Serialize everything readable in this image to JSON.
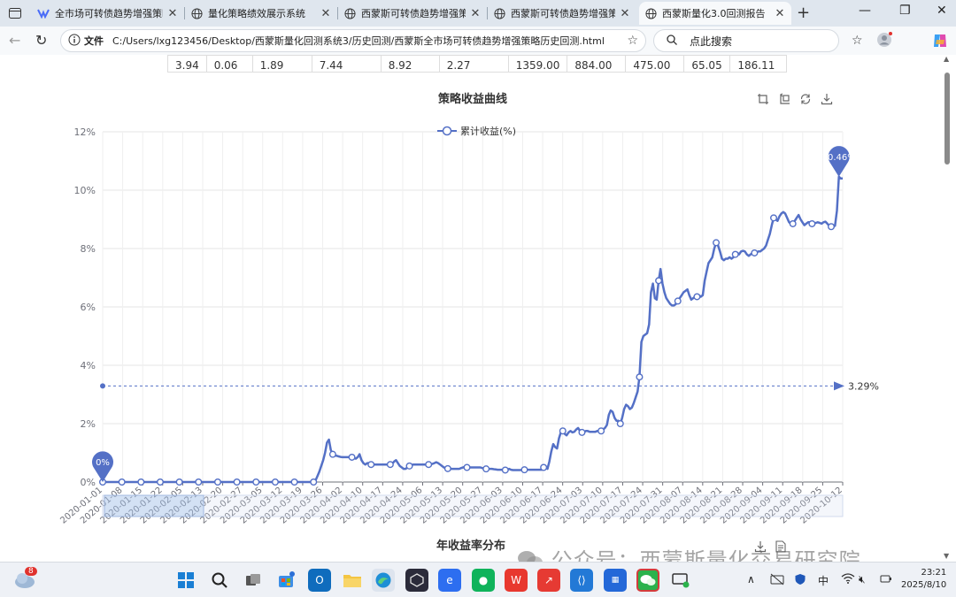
{
  "browser": {
    "tabs": [
      {
        "label": "全市场可转债趋势增强策略",
        "active": false
      },
      {
        "label": "量化策略绩效展示系统",
        "active": false
      },
      {
        "label": "西蒙斯可转债趋势增强策略",
        "active": false
      },
      {
        "label": "西蒙斯可转债趋势增强策略",
        "active": false
      },
      {
        "label": "西蒙斯量化3.0回测报告",
        "active": true
      }
    ],
    "file_label": "文件",
    "url": "C:/Users/lxg123456/Desktop/西蒙斯量化回测系统3/历史回测/西蒙斯全市场可转债趋势增强策略历史回测.html",
    "search_placeholder": "点此搜索"
  },
  "summary_row": [
    "3.94",
    "0.06",
    "1.89",
    "7.44",
    "8.92",
    "2.27",
    "1359.00",
    "884.00",
    "475.00",
    "65.05",
    "186.11"
  ],
  "chart": {
    "title": "策略收益曲线",
    "legend": "累计收益(%)",
    "color": "#5470c6",
    "y_ticks": [
      "0%",
      "2%",
      "4%",
      "6%",
      "8%",
      "10%",
      "12%"
    ],
    "x_ticks": [
      "2020-01-01",
      "2020-01-08",
      "2020-01-15",
      "2020-01-22",
      "2020-02-05",
      "2020-02-13",
      "2020-02-20",
      "2020-02-27",
      "2020-03-05",
      "2020-03-12",
      "2020-03-19",
      "2020-03-26",
      "2020-04-02",
      "2020-04-10",
      "2020-04-17",
      "2020-04-24",
      "2020-05-06",
      "2020-05-13",
      "2020-05-20",
      "2020-05-27",
      "2020-06-03",
      "2020-06-10",
      "2020-06-17",
      "2020-06-24",
      "2020-07-03",
      "2020-07-10",
      "2020-07-17",
      "2020-07-24",
      "2020-07-31",
      "2020-08-07",
      "2020-08-14",
      "2020-08-21",
      "2020-08-28",
      "2020-09-04",
      "2020-09-11",
      "2020-09-18",
      "2020-09-25",
      "2020-10-12"
    ],
    "average_label": "3.29%",
    "min_label": "0%",
    "max_label": "10.46%"
  },
  "chart_data": {
    "type": "line",
    "ylim": [
      0,
      12
    ],
    "average": 3.29,
    "series": [
      {
        "name": "累计收益(%)",
        "values": [
          0,
          0,
          0,
          0,
          0,
          0,
          0,
          0,
          0,
          0,
          0,
          0,
          0,
          0,
          0,
          0,
          0,
          0,
          0,
          0,
          0,
          0,
          0,
          0,
          0,
          0,
          0,
          0,
          0,
          0,
          0,
          0,
          0,
          0,
          0,
          0,
          0,
          0,
          0,
          0,
          0,
          0,
          0,
          0,
          0,
          0,
          0,
          0,
          0,
          0,
          0,
          0,
          0,
          0,
          0,
          0,
          0,
          0,
          0,
          0,
          0,
          0,
          0,
          0,
          0,
          0,
          0,
          0,
          0,
          0,
          0,
          0,
          0,
          0,
          0,
          0,
          0,
          0,
          0,
          0,
          0,
          0,
          0,
          0,
          0,
          0,
          0,
          0,
          0,
          0,
          0,
          0,
          0,
          0,
          0,
          0,
          0,
          0,
          0,
          0,
          0,
          0,
          0,
          0,
          0,
          0,
          0,
          0,
          0,
          0,
          0,
          0.05,
          0.2,
          0.35,
          0.55,
          0.75,
          1.0,
          1.35,
          1.45,
          1.1,
          0.95,
          0.9,
          0.9,
          0.88,
          0.86,
          0.85,
          0.85,
          0.85,
          0.85,
          0.85,
          0.85,
          0.82,
          0.8,
          0.85,
          0.95,
          0.75,
          0.65,
          0.6,
          0.65,
          0.65,
          0.6,
          0.6,
          0.6,
          0.6,
          0.6,
          0.6,
          0.6,
          0.6,
          0.6,
          0.6,
          0.6,
          0.62,
          0.7,
          0.75,
          0.65,
          0.55,
          0.5,
          0.45,
          0.45,
          0.5,
          0.55,
          0.58,
          0.6,
          0.6,
          0.6,
          0.6,
          0.6,
          0.6,
          0.6,
          0.6,
          0.6,
          0.6,
          0.62,
          0.65,
          0.68,
          0.65,
          0.6,
          0.55,
          0.5,
          0.48,
          0.46,
          0.45,
          0.45,
          0.45,
          0.45,
          0.45,
          0.45,
          0.48,
          0.5,
          0.52,
          0.5,
          0.5,
          0.5,
          0.5,
          0.5,
          0.5,
          0.5,
          0.5,
          0.48,
          0.46,
          0.45,
          0.45,
          0.45,
          0.45,
          0.44,
          0.43,
          0.42,
          0.42,
          0.42,
          0.42,
          0.41,
          0.42,
          0.45,
          0.42,
          0.41,
          0.41,
          0.41,
          0.41,
          0.41,
          0.42,
          0.42,
          0.42,
          0.42,
          0.42,
          0.42,
          0.42,
          0.42,
          0.42,
          0.42,
          0.42,
          0.5,
          0.55,
          0.45,
          0.7,
          1.05,
          1.3,
          1.2,
          1.15,
          1.5,
          1.7,
          1.75,
          1.65,
          1.6,
          1.7,
          1.75,
          1.7,
          1.72,
          1.8,
          1.85,
          1.75,
          1.7,
          1.7,
          1.75,
          1.75,
          1.72,
          1.72,
          1.72,
          1.72,
          1.75,
          1.75,
          1.75,
          1.8,
          1.85,
          1.95,
          2.3,
          2.45,
          2.4,
          2.2,
          2.1,
          2.1,
          2.0,
          2.2,
          2.5,
          2.65,
          2.6,
          2.5,
          2.55,
          2.7,
          2.9,
          3.1,
          3.6,
          4.8,
          5.0,
          5.05,
          5.1,
          5.4,
          6.5,
          6.8,
          6.3,
          6.25,
          6.9,
          7.3,
          6.8,
          6.5,
          6.3,
          6.2,
          6.1,
          6.05,
          6.05,
          6.1,
          6.2,
          6.3,
          6.4,
          6.5,
          6.55,
          6.6,
          6.4,
          6.25,
          6.3,
          6.35,
          6.35,
          6.4,
          6.35,
          6.4,
          6.9,
          7.2,
          7.5,
          7.6,
          7.7,
          8.0,
          8.2,
          8.1,
          7.9,
          7.65,
          7.6,
          7.65,
          7.65,
          7.7,
          7.65,
          7.7,
          7.8,
          7.85,
          7.8,
          7.9,
          7.92,
          7.9,
          7.8,
          7.75,
          7.8,
          7.85,
          7.85,
          7.85,
          7.9,
          7.9,
          7.95,
          8.0,
          8.1,
          8.3,
          8.5,
          8.8,
          9.05,
          9.0,
          8.95,
          9.1,
          9.2,
          9.25,
          9.2,
          9.05,
          8.9,
          8.85,
          8.85,
          8.95,
          9.05,
          9.15,
          9.0,
          8.9,
          8.8,
          8.85,
          8.9,
          8.9,
          8.85,
          8.85,
          8.88,
          8.9,
          8.88,
          8.85,
          8.9,
          8.92,
          8.85,
          8.78,
          8.75,
          8.75,
          8.78,
          9.3,
          10.46,
          10.4,
          10.4
        ]
      }
    ],
    "markers": [
      0,
      10,
      20,
      30,
      40,
      50,
      60,
      70,
      80,
      90,
      100,
      110,
      120,
      130,
      140,
      150,
      160,
      170,
      180,
      190,
      200,
      210,
      220,
      230,
      240,
      250,
      260,
      270,
      280,
      290,
      300,
      310,
      320,
      330,
      340,
      350,
      360,
      370,
      380
    ]
  },
  "next_section_title": "年收益率分布",
  "watermark": "公众号：西蒙斯量化交易研究院",
  "taskbar": {
    "weather_badge": "8",
    "ime": "中",
    "time": "23:21",
    "date": "2025/8/10"
  }
}
